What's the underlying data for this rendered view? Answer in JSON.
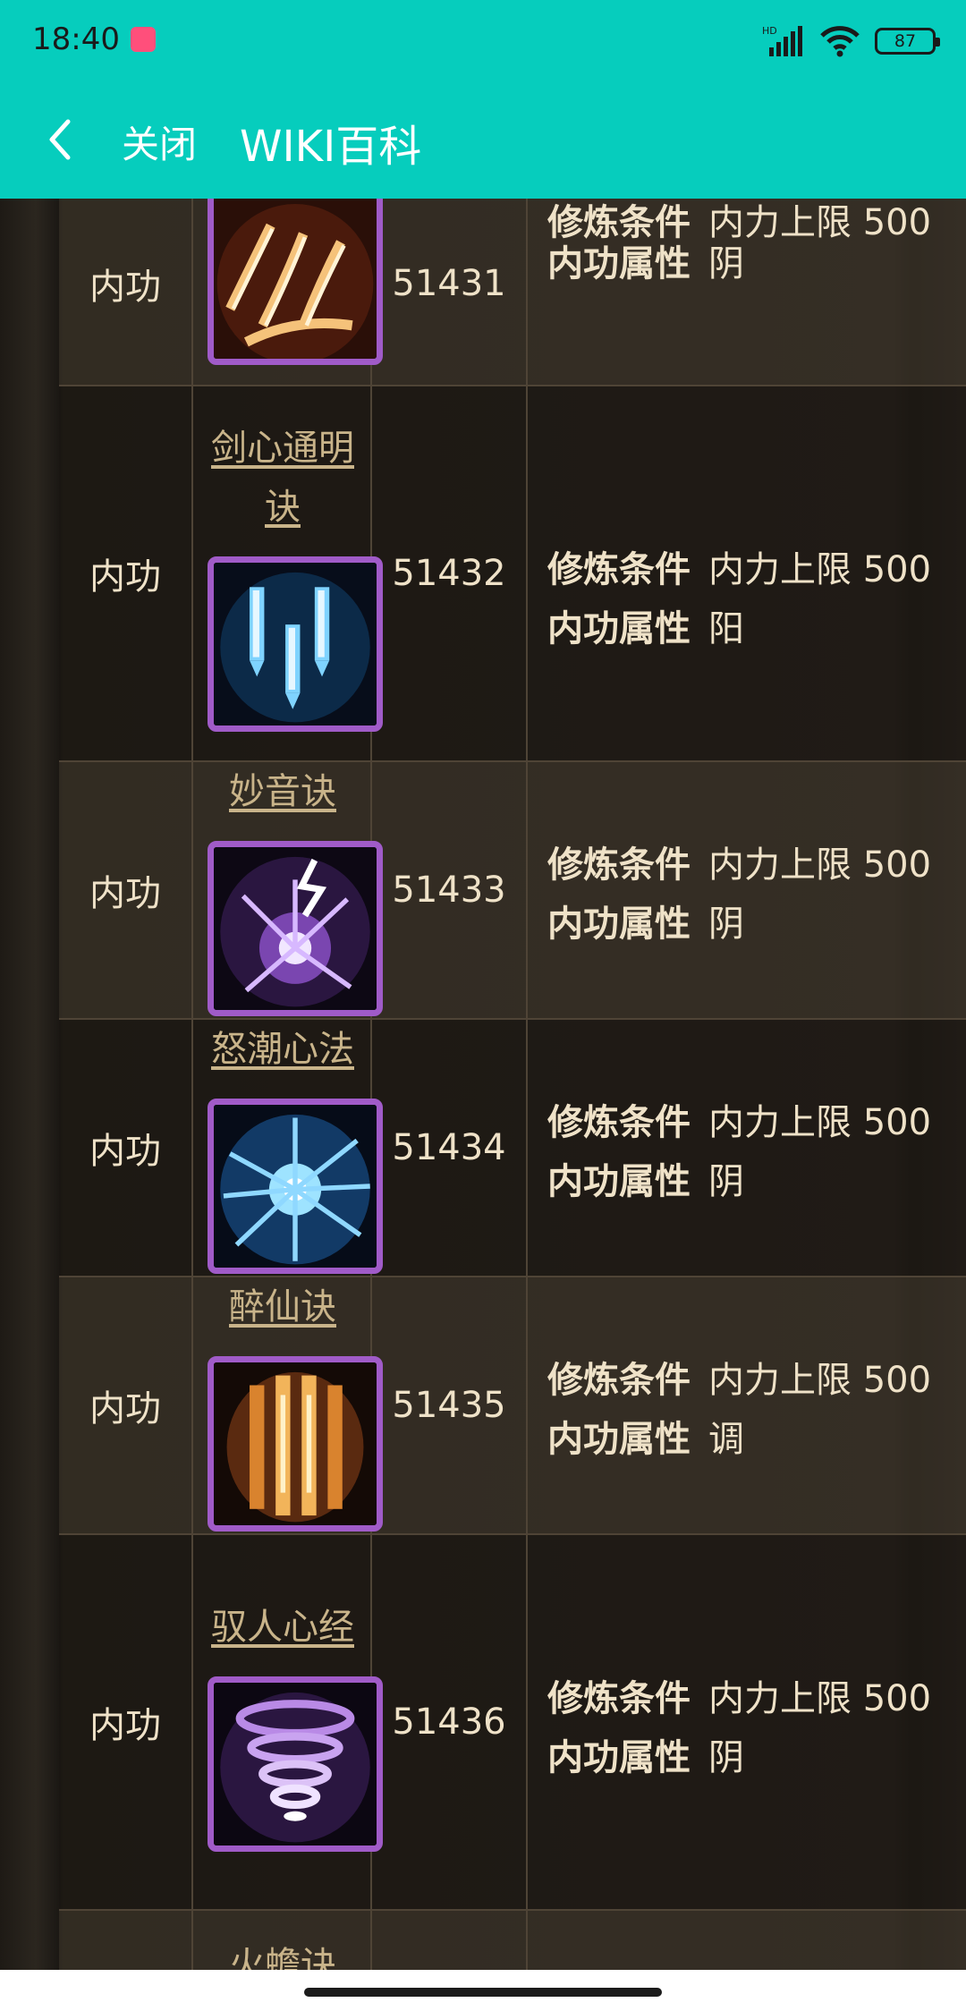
{
  "status_bar": {
    "time": "18:40",
    "battery": "87",
    "network": "HD"
  },
  "app_bar": {
    "close_label": "关闭",
    "title": "WIKI百科"
  },
  "table": {
    "rows": [
      {
        "type": "内功",
        "name": "",
        "id": "51431",
        "attrs": [
          {
            "key": "修炼条件",
            "value": "内力上限 500"
          },
          {
            "key": "内功属性",
            "value": "阴"
          }
        ],
        "icon": "fire-claw-icon"
      },
      {
        "type": "内功",
        "name": "剑心通明诀",
        "name_lines": [
          "剑心通明",
          "诀"
        ],
        "id": "51432",
        "attrs": [
          {
            "key": "修炼条件",
            "value": "内力上限 500"
          },
          {
            "key": "内功属性",
            "value": "阳"
          }
        ],
        "icon": "ice-swords-icon"
      },
      {
        "type": "内功",
        "name": "妙音诀",
        "id": "51433",
        "attrs": [
          {
            "key": "修炼条件",
            "value": "内力上限 500"
          },
          {
            "key": "内功属性",
            "value": "阴"
          }
        ],
        "icon": "purple-burst-icon"
      },
      {
        "type": "内功",
        "name": "怒潮心法",
        "id": "51434",
        "attrs": [
          {
            "key": "修炼条件",
            "value": "内力上限 500"
          },
          {
            "key": "内功属性",
            "value": "阴"
          }
        ],
        "icon": "blue-star-icon"
      },
      {
        "type": "内功",
        "name": "醉仙诀",
        "id": "51435",
        "attrs": [
          {
            "key": "修炼条件",
            "value": "内力上限 500"
          },
          {
            "key": "内功属性",
            "value": "调"
          }
        ],
        "icon": "golden-barrel-icon"
      },
      {
        "type": "内功",
        "name": "驭人心经",
        "id": "51436",
        "attrs": [
          {
            "key": "修炼条件",
            "value": "内力上限 500"
          },
          {
            "key": "内功属性",
            "value": "阴"
          }
        ],
        "icon": "purple-vortex-icon"
      },
      {
        "type": "",
        "name": "火蟾诀",
        "id": "",
        "attrs": [],
        "icon": ""
      }
    ]
  },
  "colors": {
    "teal": "#06cdbd",
    "icon_border": "#a05bc8",
    "link": "#c9b48a",
    "text": "#efe2c8"
  }
}
